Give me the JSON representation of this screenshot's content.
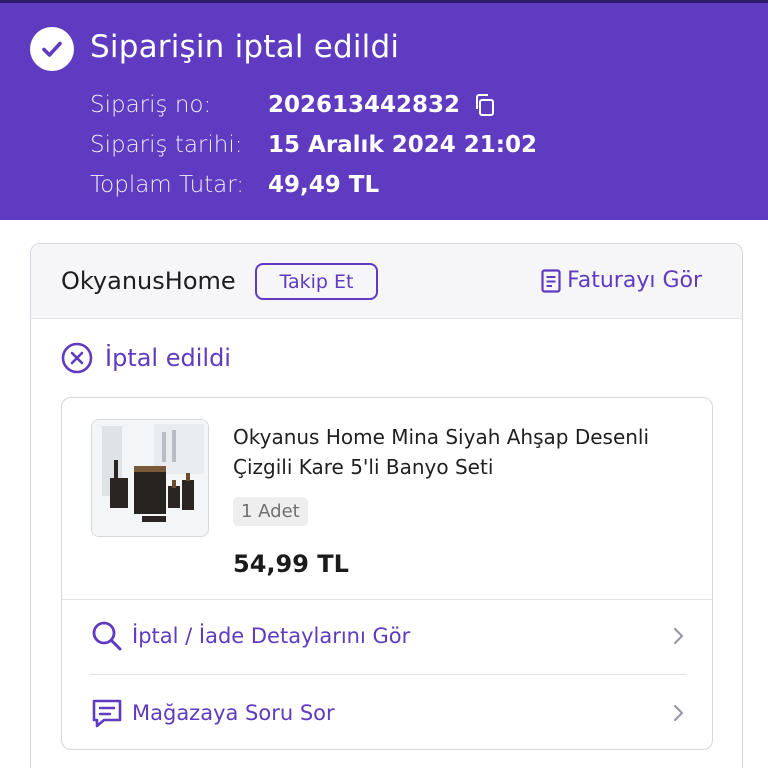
{
  "header": {
    "title": "Siparişin iptal edildi",
    "order_no_label": "Sipariş no:",
    "order_no": "202613442832",
    "order_date_label": "Sipariş tarihi:",
    "order_date": "15 Aralık 2024 21:02",
    "total_label": "Toplam Tutar:",
    "total": "49,49 TL"
  },
  "store": {
    "name": "OkyanusHome",
    "follow_label": "Takip Et",
    "invoice_label": "Faturayı Gör"
  },
  "status": {
    "label": "İptal edildi"
  },
  "product": {
    "name": "Okyanus Home Mina Siyah Ahşap Desenli Çizgili Kare 5'li Banyo Seti",
    "quantity": "1 Adet",
    "price": "54,99 TL"
  },
  "actions": {
    "details_label": "İptal / İade Detaylarını Gör",
    "ask_label": "Mağazaya Soru Sor"
  },
  "colors": {
    "brand": "#5e3bc0"
  },
  "icons": {
    "check": "check-circle-icon",
    "copy": "copy-icon",
    "invoice": "document-icon",
    "cancel": "cancel-circle-icon",
    "search": "search-icon",
    "chat": "chat-icon",
    "chevron": "chevron-right-icon"
  }
}
